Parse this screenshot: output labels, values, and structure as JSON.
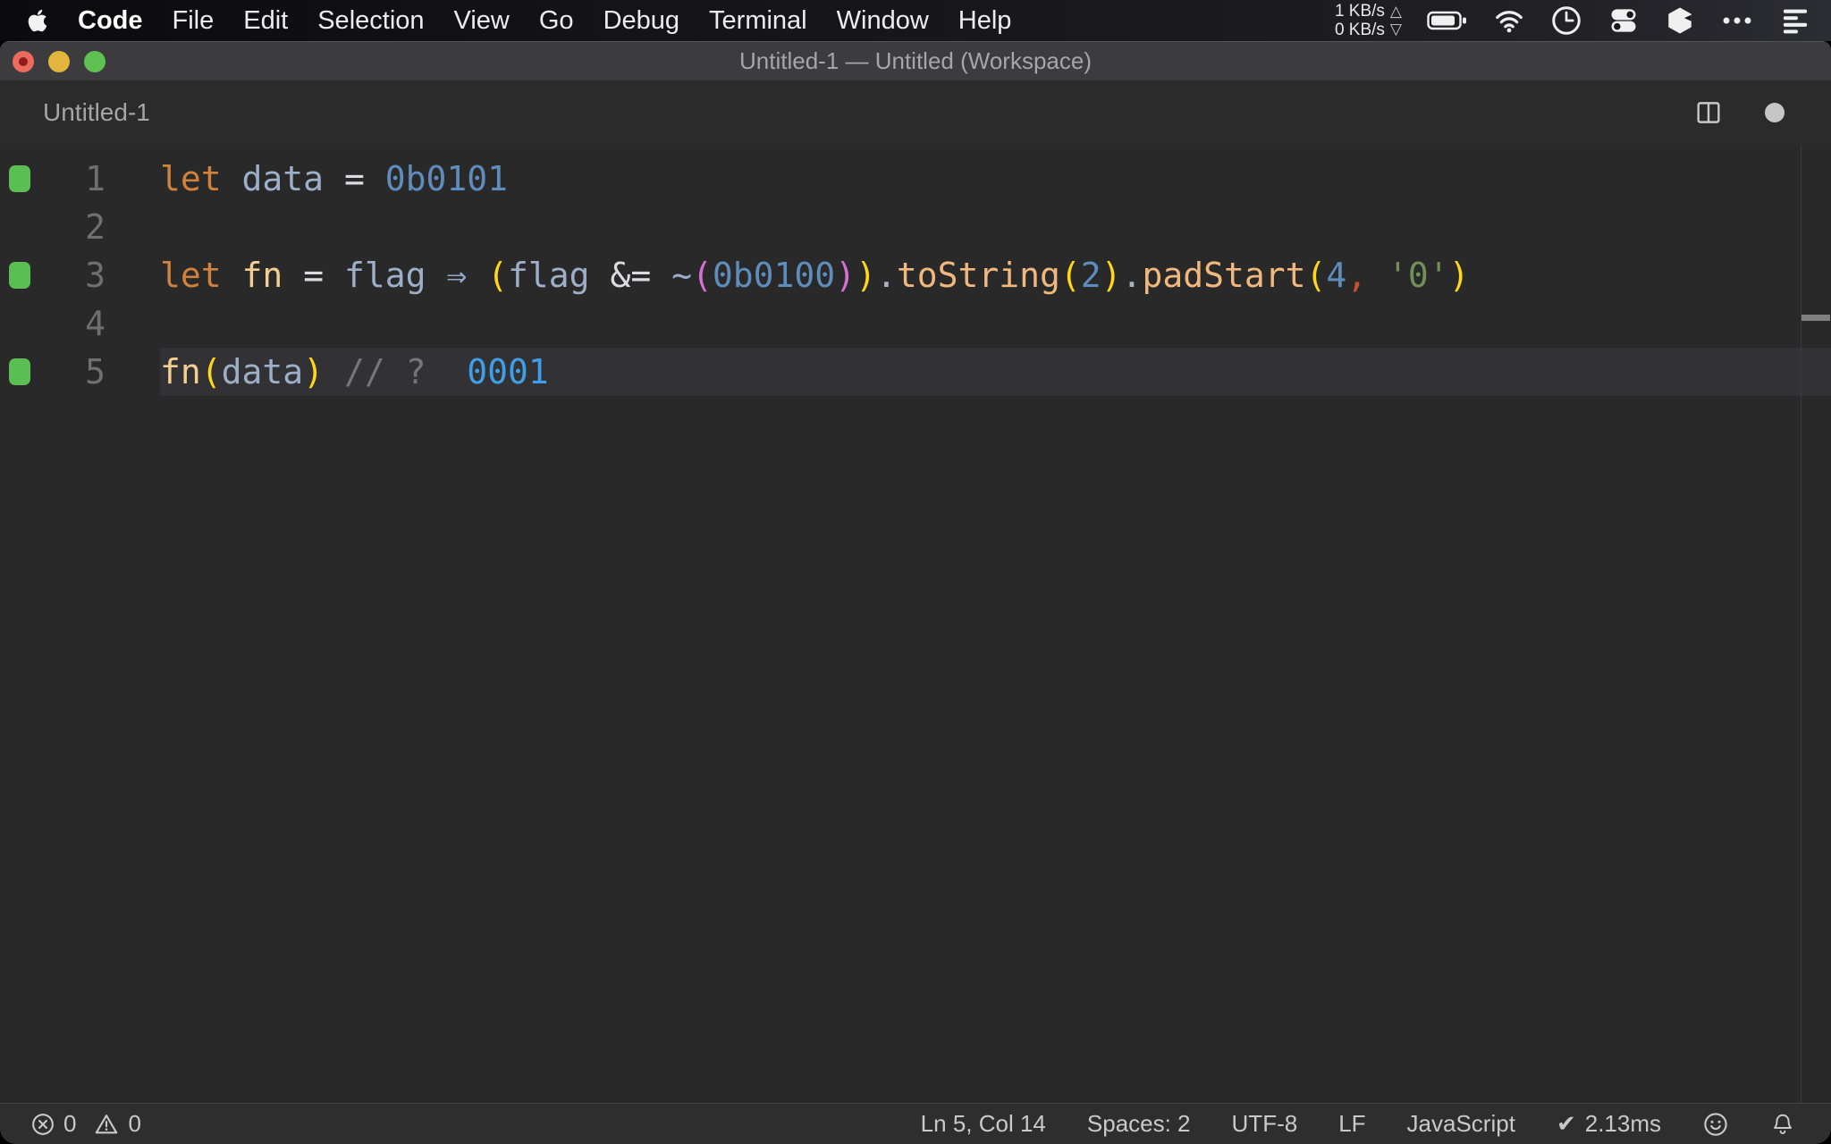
{
  "menu_bar": {
    "apple_icon": "apple-logo-icon",
    "items": [
      {
        "label": "Code",
        "name": "menu-code",
        "bold": true
      },
      {
        "label": "File",
        "name": "menu-file"
      },
      {
        "label": "Edit",
        "name": "menu-edit"
      },
      {
        "label": "Selection",
        "name": "menu-selection"
      },
      {
        "label": "View",
        "name": "menu-view"
      },
      {
        "label": "Go",
        "name": "menu-go"
      },
      {
        "label": "Debug",
        "name": "menu-debug"
      },
      {
        "label": "Terminal",
        "name": "menu-terminal"
      },
      {
        "label": "Window",
        "name": "menu-window"
      },
      {
        "label": "Help",
        "name": "menu-help"
      }
    ],
    "network": {
      "up_value": "1 KB/s",
      "up_arrow": "△",
      "down_value": "0 KB/s",
      "down_arrow": "▽"
    },
    "status_icons": [
      "battery-icon",
      "wifi-icon",
      "clock-icon",
      "control-center-icon",
      "box-icon",
      "ellipsis-icon",
      "list-menu-icon"
    ]
  },
  "window": {
    "title": "Untitled-1 — Untitled (Workspace)",
    "tab_label": "Untitled-1",
    "traffic_lights": {
      "close": "#ed6a5e",
      "close_dot": "#8c1d18",
      "minimize": "#e1b53e",
      "zoom": "#60c153"
    }
  },
  "editor": {
    "lines": [
      {
        "number": "1",
        "coverage": true,
        "current": false,
        "tokens": [
          {
            "t": "let",
            "c": "kw"
          },
          {
            "t": " ",
            "c": "plain"
          },
          {
            "t": "data",
            "c": "var"
          },
          {
            "t": " ",
            "c": "plain"
          },
          {
            "t": "=",
            "c": "op"
          },
          {
            "t": " ",
            "c": "plain"
          },
          {
            "t": "0b0101",
            "c": "num"
          }
        ]
      },
      {
        "number": "2",
        "coverage": false,
        "current": false,
        "tokens": []
      },
      {
        "number": "3",
        "coverage": true,
        "current": false,
        "tokens": [
          {
            "t": "let",
            "c": "kw"
          },
          {
            "t": " ",
            "c": "plain"
          },
          {
            "t": "fn",
            "c": "fname"
          },
          {
            "t": " ",
            "c": "plain"
          },
          {
            "t": "=",
            "c": "op"
          },
          {
            "t": " ",
            "c": "plain"
          },
          {
            "t": "flag",
            "c": "var"
          },
          {
            "t": " ",
            "c": "plain"
          },
          {
            "t": "⇒",
            "c": "arrow"
          },
          {
            "t": " ",
            "c": "plain"
          },
          {
            "t": "(",
            "c": "b1"
          },
          {
            "t": "flag",
            "c": "var"
          },
          {
            "t": " ",
            "c": "plain"
          },
          {
            "t": "&=",
            "c": "op"
          },
          {
            "t": " ",
            "c": "plain"
          },
          {
            "t": "~",
            "c": "var"
          },
          {
            "t": "(",
            "c": "b2"
          },
          {
            "t": "0b0100",
            "c": "num"
          },
          {
            "t": ")",
            "c": "b2"
          },
          {
            "t": ")",
            "c": "b1"
          },
          {
            "t": ".",
            "c": "dot"
          },
          {
            "t": "toString",
            "c": "method"
          },
          {
            "t": "(",
            "c": "b1"
          },
          {
            "t": "2",
            "c": "num"
          },
          {
            "t": ")",
            "c": "b1"
          },
          {
            "t": ".",
            "c": "dot"
          },
          {
            "t": "padStart",
            "c": "method"
          },
          {
            "t": "(",
            "c": "b1"
          },
          {
            "t": "4",
            "c": "num"
          },
          {
            "t": ",",
            "c": "comma"
          },
          {
            "t": " ",
            "c": "plain"
          },
          {
            "t": "'0'",
            "c": "str"
          },
          {
            "t": ")",
            "c": "b1"
          }
        ]
      },
      {
        "number": "4",
        "coverage": false,
        "current": false,
        "tokens": []
      },
      {
        "number": "5",
        "coverage": true,
        "current": true,
        "tokens": [
          {
            "t": "fn",
            "c": "fname"
          },
          {
            "t": "(",
            "c": "b1"
          },
          {
            "t": "data",
            "c": "var"
          },
          {
            "t": ")",
            "c": "b1"
          },
          {
            "t": " ",
            "c": "plain"
          },
          {
            "t": "//",
            "c": "comment"
          },
          {
            "t": " ",
            "c": "plain"
          },
          {
            "t": "?",
            "c": "comment"
          },
          {
            "t": "  ",
            "c": "plain"
          },
          {
            "t": "0001",
            "c": "result"
          }
        ]
      }
    ]
  },
  "status_bar": {
    "errors": "0",
    "warnings": "0",
    "items": [
      {
        "label": "Ln 5, Col 14",
        "name": "cursor-position"
      },
      {
        "label": "Spaces: 2",
        "name": "indentation"
      },
      {
        "label": "UTF-8",
        "name": "encoding"
      },
      {
        "label": "LF",
        "name": "eol-selector"
      },
      {
        "label": "JavaScript",
        "name": "language-mode"
      }
    ],
    "perf": {
      "check": "✔",
      "value": "2.13ms"
    }
  },
  "colors": {
    "tokens": {
      "kw": "#d0813d",
      "var": "#9caec8",
      "op": "#dcdcde",
      "num": "#5e8cbb",
      "fname": "#f2ce92",
      "method": "#f0b87e",
      "b1": "#ffd61a",
      "b2": "#d670d6",
      "dot": "#a9b2c0",
      "comma": "#c7502f",
      "str": "#71915b",
      "comment": "#757575",
      "result": "#3e9fe8",
      "arrow": "#93a9c9",
      "plain": "#d4d4d4"
    },
    "coverage_square": "#5abf52",
    "current_line_bg": "#323234"
  }
}
